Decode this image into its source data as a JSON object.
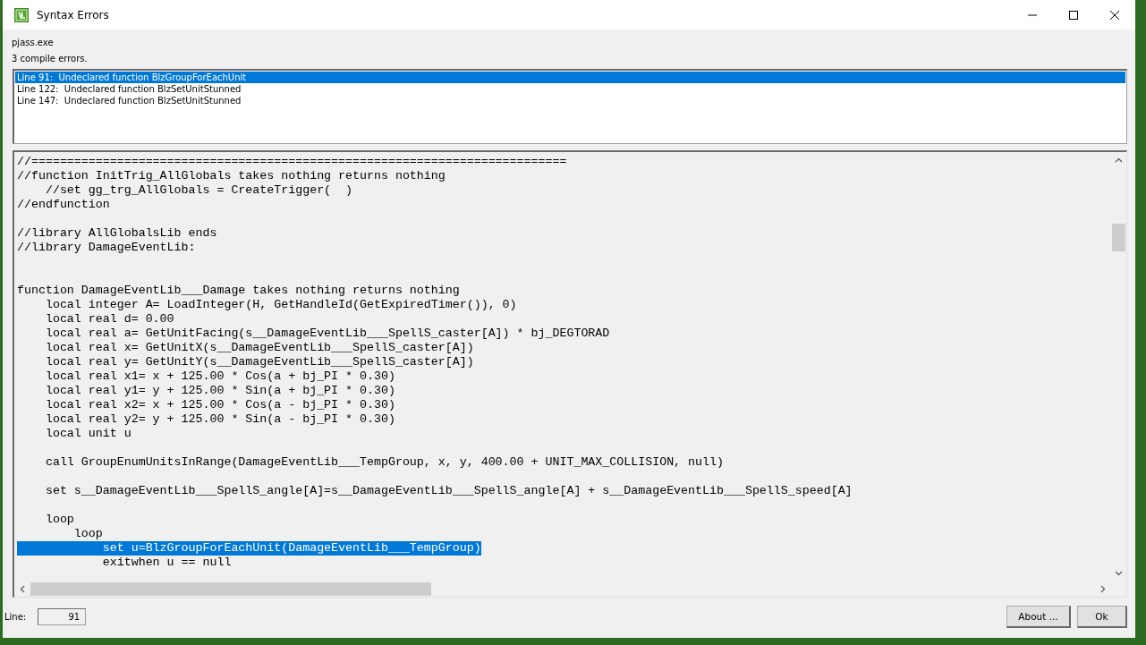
{
  "window": {
    "title": "Syntax Errors"
  },
  "compiler": "pjass.exe",
  "summary": "3 compile errors.",
  "errors": [
    {
      "text": "Line 91:  Undeclared function BlzGroupForEachUnit",
      "selected": true
    },
    {
      "text": "Line 122:  Undeclared function BlzSetUnitStunned",
      "selected": false
    },
    {
      "text": "Line 147:  Undeclared function BlzSetUnitStunned",
      "selected": false
    }
  ],
  "code_lines": [
    {
      "kind": "code",
      "text": "//===========================================================================",
      "selected": false
    },
    {
      "kind": "code",
      "text": "//function InitTrig_AllGlobals takes nothing returns nothing",
      "selected": false
    },
    {
      "kind": "code",
      "text": "    //set gg_trg_AllGlobals = CreateTrigger(  )",
      "selected": false
    },
    {
      "kind": "code",
      "text": "//endfunction",
      "selected": false
    },
    {
      "kind": "blank"
    },
    {
      "kind": "code",
      "text": "//library AllGlobalsLib ends",
      "selected": false
    },
    {
      "kind": "code",
      "text": "//library DamageEventLib:",
      "selected": false
    },
    {
      "kind": "blank"
    },
    {
      "kind": "blank"
    },
    {
      "kind": "code",
      "text": "function DamageEventLib___Damage takes nothing returns nothing",
      "selected": false
    },
    {
      "kind": "code",
      "text": "    local integer A= LoadInteger(H, GetHandleId(GetExpiredTimer()), 0)",
      "selected": false
    },
    {
      "kind": "code",
      "text": "    local real d= 0.00",
      "selected": false
    },
    {
      "kind": "code",
      "text": "    local real a= GetUnitFacing(s__DamageEventLib___SpellS_caster[A]) * bj_DEGTORAD",
      "selected": false
    },
    {
      "kind": "code",
      "text": "    local real x= GetUnitX(s__DamageEventLib___SpellS_caster[A])",
      "selected": false
    },
    {
      "kind": "code",
      "text": "    local real y= GetUnitY(s__DamageEventLib___SpellS_caster[A])",
      "selected": false
    },
    {
      "kind": "code",
      "text": "    local real x1= x + 125.00 * Cos(a + bj_PI * 0.30)",
      "selected": false
    },
    {
      "kind": "code",
      "text": "    local real y1= y + 125.00 * Sin(a + bj_PI * 0.30)",
      "selected": false
    },
    {
      "kind": "code",
      "text": "    local real x2= x + 125.00 * Cos(a - bj_PI * 0.30)",
      "selected": false
    },
    {
      "kind": "code",
      "text": "    local real y2= y + 125.00 * Sin(a - bj_PI * 0.30)",
      "selected": false
    },
    {
      "kind": "code",
      "text": "    local unit u",
      "selected": false
    },
    {
      "kind": "blank"
    },
    {
      "kind": "code",
      "text": "    call GroupEnumUnitsInRange(DamageEventLib___TempGroup, x, y, 400.00 + UNIT_MAX_COLLISION, null)",
      "selected": false
    },
    {
      "kind": "blank"
    },
    {
      "kind": "code",
      "text": "    set s__DamageEventLib___SpellS_angle[A]=s__DamageEventLib___SpellS_angle[A] + s__DamageEventLib___SpellS_speed[A]",
      "selected": false
    },
    {
      "kind": "blank"
    },
    {
      "kind": "code",
      "text": "    loop",
      "selected": false
    },
    {
      "kind": "code",
      "text": "        loop",
      "selected": false
    },
    {
      "kind": "code",
      "text": "            set u=BlzGroupForEachUnit(DamageEventLib___TempGroup)",
      "selected": true
    },
    {
      "kind": "code",
      "text": "            exitwhen u == null",
      "selected": false
    }
  ],
  "line_field": {
    "label": "Line:",
    "value": "91"
  },
  "buttons": [
    "About ...",
    "Ok"
  ]
}
